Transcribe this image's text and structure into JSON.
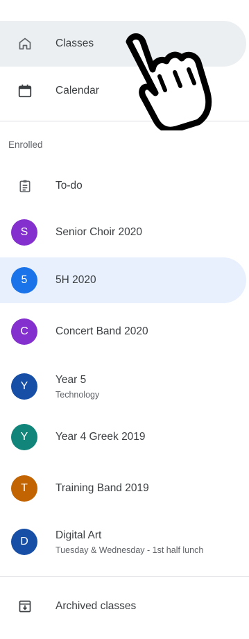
{
  "nav": {
    "classes_label": "Classes",
    "calendar_label": "Calendar",
    "section_enrolled": "Enrolled",
    "todo_label": "To-do",
    "archived_label": "Archived classes"
  },
  "classes": [
    {
      "initial": "S",
      "name": "Senior Choir 2020",
      "subtitle": "",
      "color": "#8430ce"
    },
    {
      "initial": "5",
      "name": "5H 2020",
      "subtitle": "",
      "color": "#1a73e8"
    },
    {
      "initial": "C",
      "name": "Concert Band 2020",
      "subtitle": "",
      "color": "#8430ce"
    },
    {
      "initial": "Y",
      "name": "Year 5",
      "subtitle": "Technology",
      "color": "#174ea6"
    },
    {
      "initial": "Y",
      "name": "Year 4 Greek 2019",
      "subtitle": "",
      "color": "#12857a"
    },
    {
      "initial": "T",
      "name": "Training Band 2019",
      "subtitle": "",
      "color": "#c26401"
    },
    {
      "initial": "D",
      "name": "Digital Art",
      "subtitle": "Tuesday & Wednesday - 1st half lunch",
      "color": "#174ea6"
    }
  ],
  "colors": {
    "active_gray": "#eceff1",
    "active_blue": "#e8f0fe",
    "icon": "#5f6368"
  },
  "icons": [
    "home-icon",
    "calendar-icon",
    "assignment-icon",
    "archive-icon",
    "hand-pointer-icon"
  ]
}
